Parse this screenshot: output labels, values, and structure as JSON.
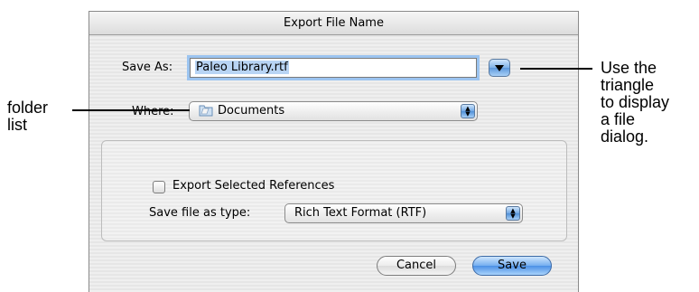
{
  "dialog": {
    "title": "Export File Name",
    "save_as_label": "Save As:",
    "save_as_value": "Paleo Library.rtf",
    "triangle_button_icon": "disclosure-triangle-icon",
    "where_label": "Where:",
    "where_value": "Documents",
    "where_icon": "folder-icon",
    "export_selected_label": "Export Selected References",
    "export_selected_checked": false,
    "file_type_label": "Save file as type:",
    "file_type_value": "Rich Text Format (RTF)",
    "cancel_label": "Cancel",
    "save_label": "Save"
  },
  "annotations": {
    "folder_list": [
      "folder",
      "list"
    ],
    "triangle": [
      "Use the",
      "triangle",
      "to display",
      "a file",
      "dialog."
    ]
  },
  "colors": {
    "accent_blue": "#5d98dc",
    "focus_ring": "#9cc4f0",
    "selection": "#b8d4f4"
  }
}
